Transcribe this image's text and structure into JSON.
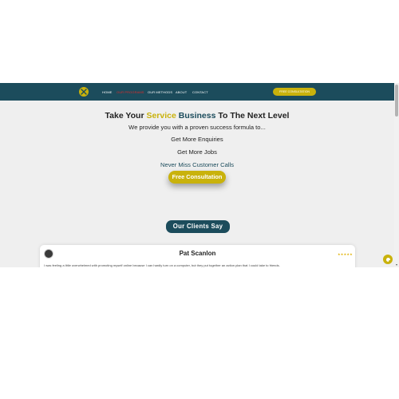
{
  "nav": {
    "items": [
      {
        "label": "HOME"
      },
      {
        "label": "OUR PROGRAMS"
      },
      {
        "label": "OUR METHODS"
      },
      {
        "label": "ABOUT"
      },
      {
        "label": "CONTACT"
      }
    ],
    "cta_label": "FREE CONSULTATION",
    "logo_icon": "wrench-screwdriver-icon"
  },
  "hero": {
    "title_part1": "Take Your ",
    "title_highlight1": "Service",
    "title_part2": " ",
    "title_highlight2": "Business",
    "title_part3": " To The Next Level",
    "subtitle": "We provide you with a proven success formula to...",
    "benefits": [
      "Get More Enquiries",
      "Get More Jobs",
      "Never Miss Customer Calls"
    ],
    "cta_label": "Free Consultation"
  },
  "clients": {
    "section_title": "Our Clients Say",
    "reviews": [
      {
        "name": "Pat Scanlon",
        "stars": "★★★★★",
        "text": "I was feeling a little overwhelmed with promoting myself online because I can hardly turn on a computer, but they put together an action plan that I could take to friends."
      }
    ]
  },
  "colors": {
    "brand_dark": "#1c4c5c",
    "brand_gold": "#c9b20c",
    "active_nav": "#e02b2b",
    "background": "#efefef"
  },
  "widgets": {
    "chat_icon": "chat-icon"
  }
}
